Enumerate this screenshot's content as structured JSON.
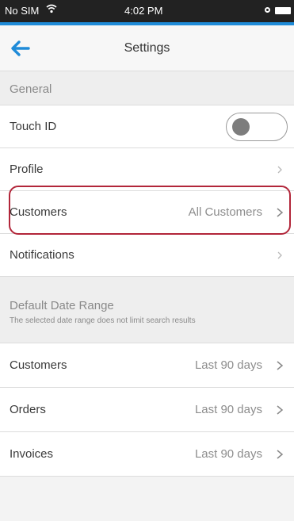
{
  "status_bar": {
    "carrier": "No SIM",
    "time": "4:02 PM"
  },
  "header": {
    "title": "Settings"
  },
  "general": {
    "section_title": "General",
    "touch_id_label": "Touch ID",
    "touch_id_enabled": false,
    "profile_label": "Profile",
    "customers_label": "Customers",
    "customers_value": "All Customers",
    "notifications_label": "Notifications"
  },
  "date_range": {
    "section_title": "Default Date Range",
    "section_note": "The selected date range does not limit search results",
    "rows": [
      {
        "label": "Customers",
        "value": "Last 90 days"
      },
      {
        "label": "Orders",
        "value": "Last 90 days"
      },
      {
        "label": "Invoices",
        "value": "Last 90 days"
      }
    ]
  },
  "colors": {
    "accent": "#1f8bd8",
    "highlight": "#b2263a"
  }
}
